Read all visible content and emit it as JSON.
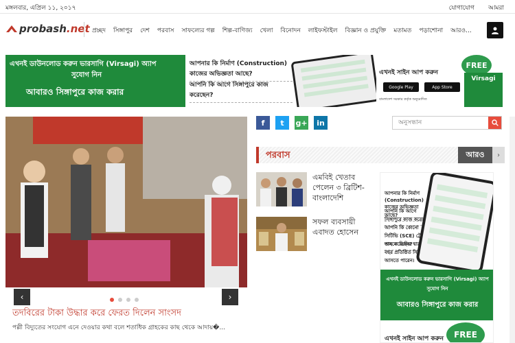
{
  "topbar": {
    "date": "মঙ্গলবার, এপ্রিল ১১, ২০১৭",
    "links": [
      "যোগাযোগ",
      "আমরা"
    ]
  },
  "logo": {
    "part1": "probash",
    "part2": ".net"
  },
  "nav": [
    "প্রচ্ছদ",
    "সিঙ্গাপুর",
    "দেশ",
    "পরবাস",
    "সাফল্যের গল্প",
    "শিল্প-বাণিজ্য",
    "খেলা",
    "বিনোদন",
    "লাইফস্টাইল",
    "বিজ্ঞান ও প্রযুক্তি",
    "মতামত",
    "পড়াশোনা",
    "আরও..."
  ],
  "ad_banner": {
    "line1": "এখনই ডাউনলোড করুন ভারসাগি (Virsagi) অ্যাপ",
    "line2": "সুযোগ নিন",
    "line3": "আবারও সিঙ্গাপুরে কাজ করার",
    "q1": "আপনার কি নির্মাণ (Construction) কাজের অভিজ্ঞতা আছে?",
    "q2": "আপনি কি আগে সিঙ্গাপুরে কাজ করেছেন?",
    "signup": "এখনই সাইন আপ করুন",
    "google_play": "Google Play",
    "app_store": "App Store",
    "approval": "বাংলাদেশ সরকার কর্তৃক অনুমোদিত",
    "free": "FREE",
    "brand": "Virsagi"
  },
  "slider": {
    "prev": "‹",
    "next": "›",
    "headline": "তদবিরের টাকা উদ্ধার করে ফেরত দিলেন সাংসদ",
    "summary": "পল্লী বিদ্যুতের সংযোগ এনে দেওয়ার কথা বলে শতাধিক গ্রাহকের কাছ থেকে আদায়�..."
  },
  "social": [
    "f",
    "t",
    "g+",
    "in"
  ],
  "search": {
    "placeholder": "অনুসন্ধান"
  },
  "section": {
    "title": "পরবাস",
    "more": "আরও",
    "more_arrow": "›"
  },
  "news": [
    {
      "title": "এমবিই খেতাব পেলেন ৩ ব্রিটিশ-বাংলাদেশি"
    },
    {
      "title": "সফল ব্যবসায়ী এবাদত হোসেন"
    }
  ],
  "ad_side": {
    "q1": "আপনার কি নির্মাণ (Construction) কাজের অভিজ্ঞতা আছে?",
    "q2": "আপনি কি আগে সিঙ্গাপুরে কাজ করেছেন?",
    "q3": "আপনি কি কোনো সিটিভি (SCE) ট্রেড পাস করেছেন?",
    "q4": "তাহলে ভিসির দ্বারা এক বছর প্রতিষ্ঠিত সিঙ্গাপুরে আসতে পারেন।",
    "g1": "এখনই ডাউনলোড করুন ভারসাগি (Virsagi) অ্যাপ",
    "g2": "সুযোগ নিন",
    "g3": "আবারও সিঙ্গাপুরে কাজ করার",
    "free": "FREE",
    "signup": "এখনই সাইন আপ করুন"
  },
  "colors": {
    "accent": "#c0392b",
    "green": "#1f8a3b",
    "facebook": "#3b5998",
    "twitter": "#1da1f2",
    "googleplus": "#3aa757",
    "linkedin": "#0e76a8"
  }
}
